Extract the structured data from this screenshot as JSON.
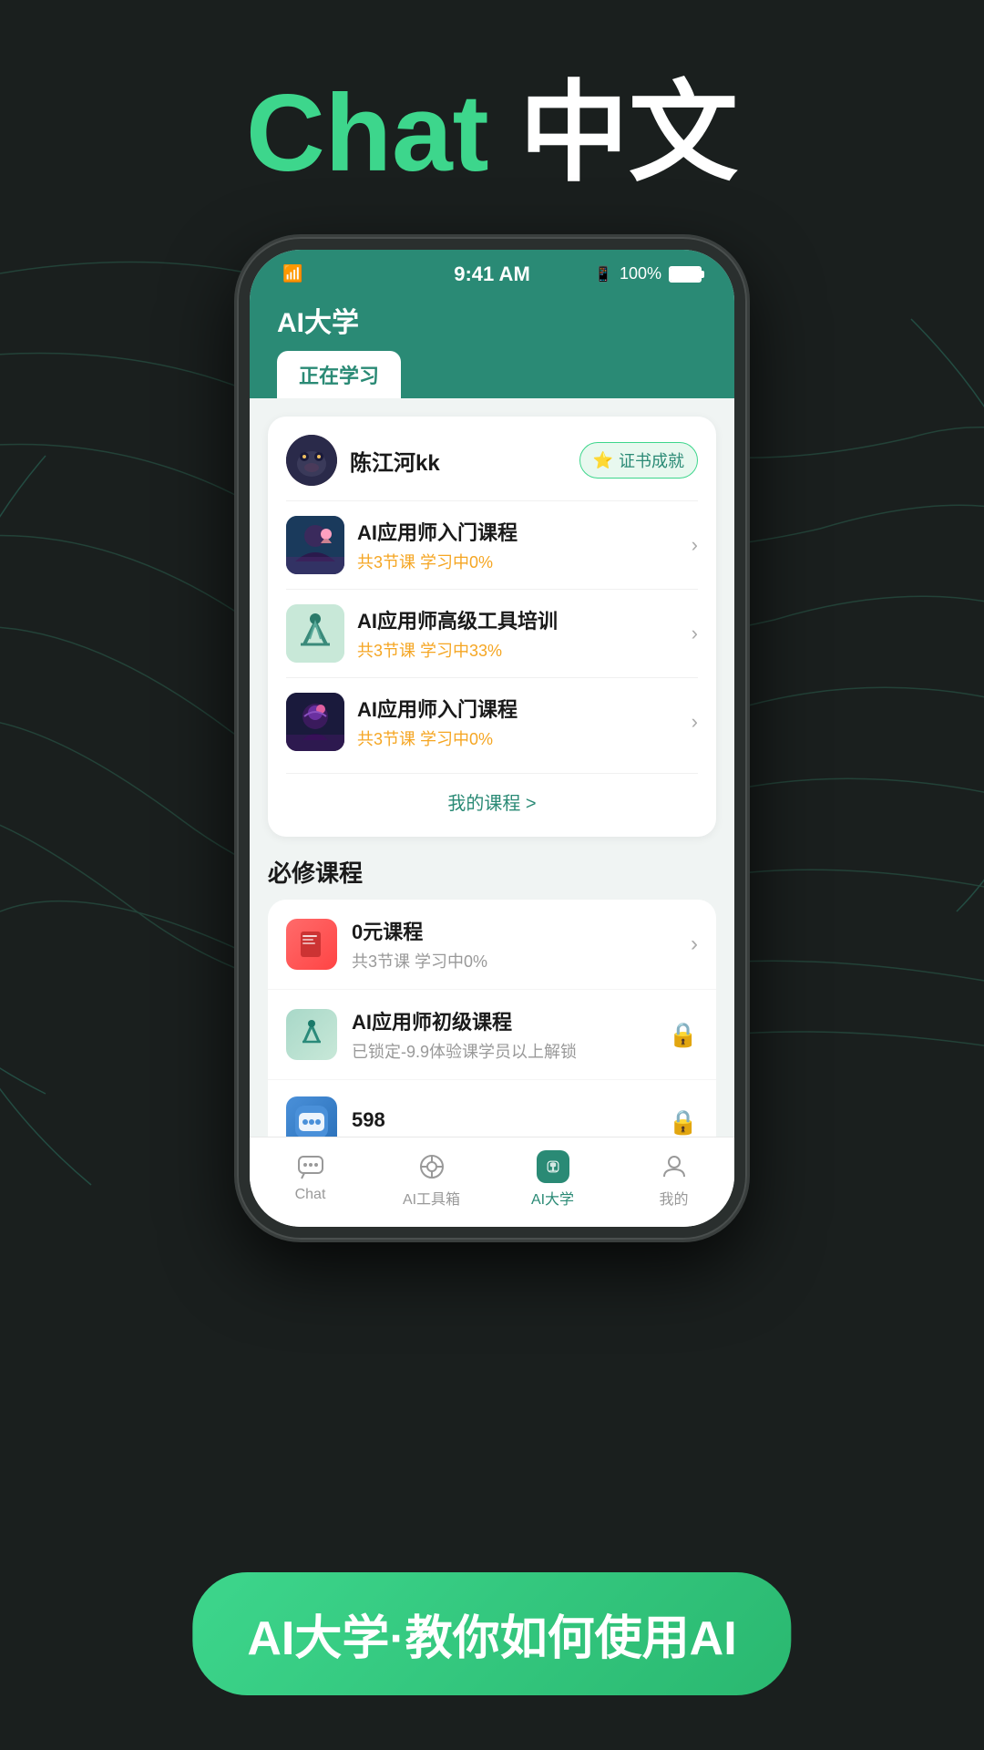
{
  "background": {
    "color": "#1a1f1e"
  },
  "header": {
    "chat_label": "Chat",
    "chinese_label": "中文"
  },
  "phone": {
    "status_bar": {
      "time": "9:41 AM",
      "battery": "100%",
      "wifi": "wifi"
    },
    "app_title": "AI大学",
    "active_tab": "正在学习",
    "user": {
      "name": "陈江河kk",
      "cert_badge": "证书成就"
    },
    "courses_in_progress": [
      {
        "name": "AI应用师入门课程",
        "meta": "共3节课  学习中0%",
        "thumb_type": "1"
      },
      {
        "name": "AI应用师高级工具培训",
        "meta": "共3节课  学习中33%",
        "thumb_type": "2"
      },
      {
        "name": "AI应用师入门课程",
        "meta": "共3节课  学习中0%",
        "thumb_type": "3"
      }
    ],
    "my_courses_link": "我的课程 >",
    "required_section_title": "必修课程",
    "required_courses": [
      {
        "name": "0元课程",
        "meta": "共3节课  学习中0%",
        "icon_type": "red",
        "action": "arrow",
        "icon_symbol": "📕"
      },
      {
        "name": "AI应用师初级课程",
        "meta": "已锁定-9.9体验课学员以上解锁",
        "icon_type": "teal",
        "action": "lock",
        "icon_symbol": "🤖"
      },
      {
        "name": "598",
        "meta": "",
        "icon_type": "blue",
        "action": "lock",
        "icon_symbol": "💬"
      }
    ],
    "bottom_nav": [
      {
        "label": "Chat",
        "icon": "chat",
        "active": false
      },
      {
        "label": "AI工具箱",
        "icon": "toolbox",
        "active": false
      },
      {
        "label": "AI大学",
        "icon": "university",
        "active": true
      },
      {
        "label": "我的",
        "icon": "profile",
        "active": false
      }
    ]
  },
  "cta": {
    "text": "AI大学·教你如何使用AI"
  }
}
